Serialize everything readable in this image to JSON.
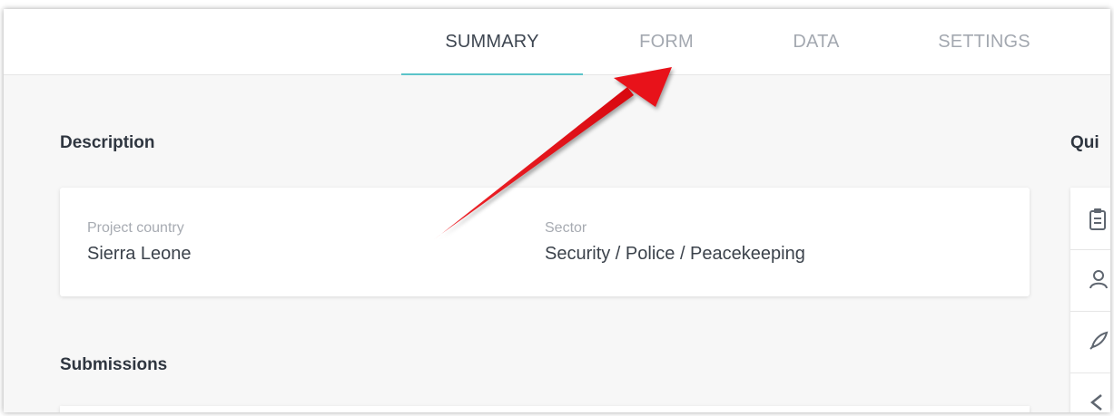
{
  "tabs": [
    {
      "label": "SUMMARY",
      "active": true
    },
    {
      "label": "FORM",
      "active": false
    },
    {
      "label": "DATA",
      "active": false
    },
    {
      "label": "SETTINGS",
      "active": false
    }
  ],
  "description": {
    "title": "Description",
    "fields": [
      {
        "label": "Project country",
        "value": "Sierra Leone"
      },
      {
        "label": "Sector",
        "value": "Security / Police / Peacekeeping"
      }
    ]
  },
  "submissions": {
    "title": "Submissions"
  },
  "quick_links": {
    "title": "Qui",
    "icons": [
      "clipboard-icon",
      "user-icon",
      "rocket-icon",
      "chevron-left-icon"
    ]
  },
  "colors": {
    "accent": "#5bc4c9",
    "annotation_arrow": "#e8121a"
  }
}
